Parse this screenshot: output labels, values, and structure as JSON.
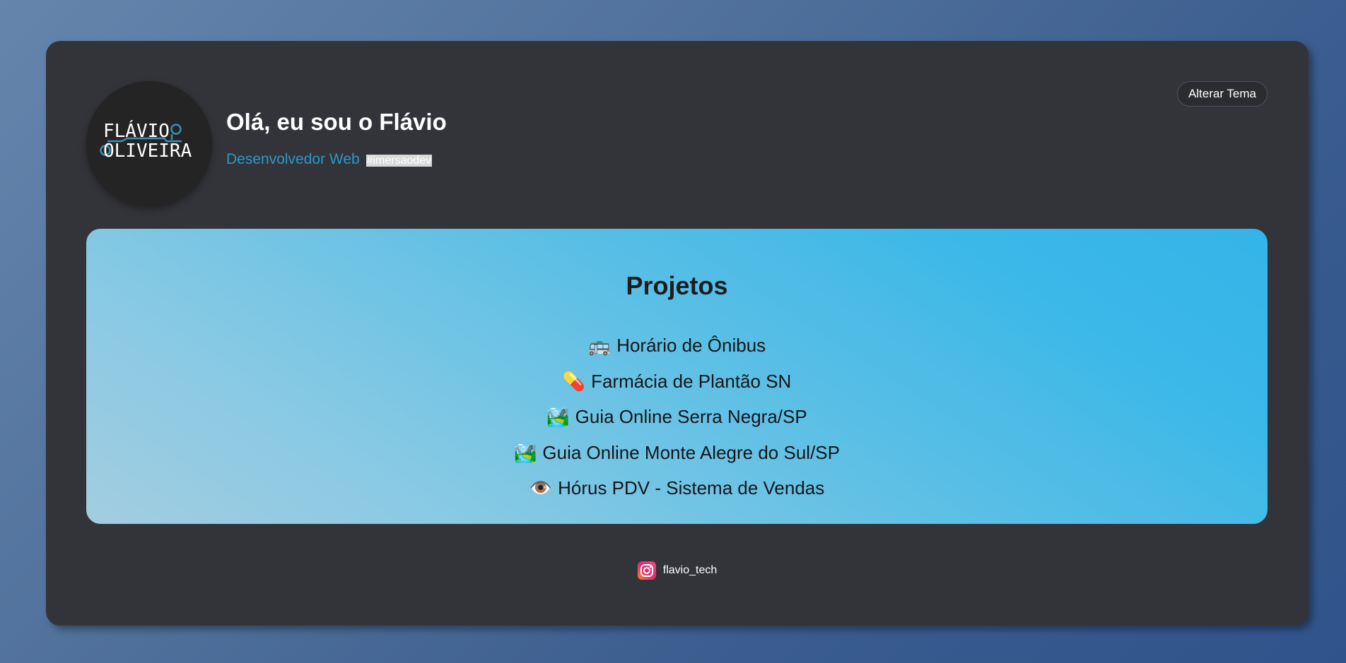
{
  "header": {
    "theme_button": "Alterar Tema",
    "greeting": "Olá, eu sou o Flávio",
    "role": "Desenvolvedor Web",
    "hashtag": "#imersaodev",
    "logo": {
      "line1": "FLÁVIO",
      "line2": "OLIVEIRA"
    }
  },
  "projects": {
    "title": "Projetos",
    "items": [
      {
        "icon": "🚌",
        "label": "Horário de Ônibus"
      },
      {
        "icon": "💊",
        "label": "Farmácia de Plantão SN"
      },
      {
        "icon": "🏞️",
        "label": "Guia Online Serra Negra/SP"
      },
      {
        "icon": "🏞️",
        "label": "Guia Online Monte Alegre do Sul/SP"
      },
      {
        "icon": "👁️",
        "label": "Hórus PDV - Sistema de Vendas"
      }
    ]
  },
  "footer": {
    "instagram": "flavio_tech",
    "instagram_icon": "instagram-icon"
  },
  "colors": {
    "card": "#333439",
    "accent": "#2b97c7",
    "projects_gradient_start": "#a3cde0",
    "projects_gradient_end": "#33b4e8"
  }
}
